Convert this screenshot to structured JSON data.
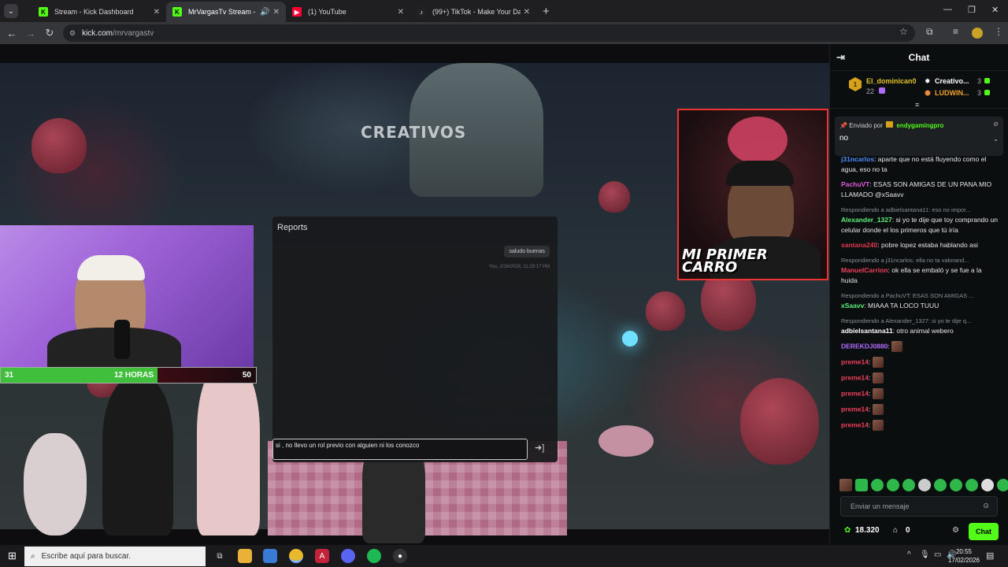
{
  "browser": {
    "tabs": [
      {
        "label": "Stream - Kick Dashboard",
        "fav_letter": "K",
        "fav_color": "#53fc18",
        "active": false
      },
      {
        "label": "MrVargasTv Stream - Watch",
        "fav_letter": "K",
        "fav_color": "#53fc18",
        "active": true
      },
      {
        "label": "(1) YouTube",
        "fav_letter": "▶",
        "fav_color": "#ff0033",
        "active": false
      },
      {
        "label": "(99+) TikTok - Make Your Day",
        "fav_letter": "♪",
        "fav_color": "#222222",
        "active": false
      }
    ],
    "url_host": "kick.com",
    "url_path": "/mrvargastv"
  },
  "stream": {
    "server_logo": "CREATIVOS",
    "left_bar": {
      "left": "31",
      "center": "12 HORAS",
      "right": "50"
    },
    "right_cam_label": "MI PRIMER CARRO",
    "reports": {
      "title": "Reports",
      "bubble": "saludo buenas",
      "meta": "You, 2/16/2026, 11:29:17 PM",
      "input_value": "si , no llevo un rol previo con alguien ni los conozco"
    }
  },
  "chat": {
    "title": "Chat",
    "leaders": [
      {
        "rank": "1",
        "name": "El_dominican0",
        "count": "22"
      },
      {
        "name": "Creativo...",
        "count": "3"
      },
      {
        "name": "LUDWIN...",
        "count": "3"
      }
    ],
    "pinned": {
      "prefix": "Enviado por",
      "user": "endygamingpro",
      "text": "no"
    },
    "messages": [
      {
        "user": "j31ncarlos",
        "color": "#4b8dfa",
        "text": "aparte que no está fluyendo como el agua, eso no ta"
      },
      {
        "user": "PachuVT",
        "color": "#e05ad8",
        "text": "ESAS SON AMIGAS DE UN PANA MIO LLAMADO @xSaavv"
      },
      {
        "reply": "Respondiendo a adbielsantana11: eso no impor...",
        "user": "Alexander_1327",
        "color": "#5df07a",
        "text": "si yo te dije que toy comprando un celular donde el los primeros que tú iría"
      },
      {
        "user": "santana240",
        "color": "#e0394f",
        "text": "pobre lopez estaba hablando asi"
      },
      {
        "reply": "Respondiendo a j31ncarlos: ella no ta valorand...",
        "user": "ManuelCarrion",
        "color": "#f0405a",
        "text": "ok ella se embaló y se fue a la huida"
      },
      {
        "reply": "Respondiendo a PachuVT: ESAS SON AMIGAS ...",
        "user": "xSaavv",
        "color": "#5df07a",
        "text": "MIAAA TA LOCO TUUU"
      },
      {
        "reply": "Respondiendo a Alexander_1327: si yo te dije q...",
        "user": "adbielsantana11",
        "color": "#ffffff",
        "text": "otro animal webero"
      },
      {
        "user": "DEREKDJ0880",
        "color": "#b06cff",
        "text": ""
      },
      {
        "user": "preme14",
        "color": "#f0405a",
        "text": ""
      },
      {
        "user": "preme14",
        "color": "#f0405a",
        "text": ""
      },
      {
        "user": "preme14",
        "color": "#f0405a",
        "text": ""
      },
      {
        "user": "preme14",
        "color": "#f0405a",
        "text": ""
      },
      {
        "user": "preme14",
        "color": "#f0405a",
        "text": ""
      }
    ],
    "input_placeholder": "Enviar un mensaje",
    "points": "18.320",
    "gifts": "0",
    "chat_button": "Chat"
  },
  "taskbar": {
    "search_placeholder": "Escribe aquí para buscar.",
    "time": "20:55",
    "date": "17/02/2026"
  },
  "colors": {
    "kick_green": "#53fc18",
    "accent_red": "#e33333"
  }
}
